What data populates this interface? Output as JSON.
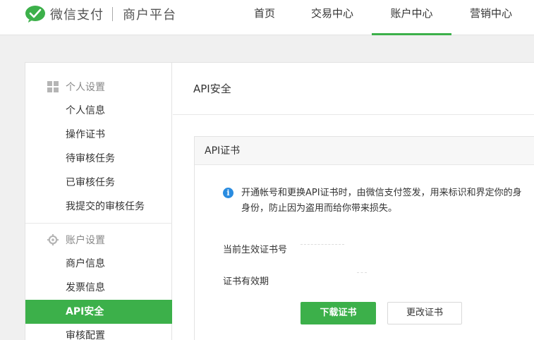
{
  "header": {
    "brand_name": "微信支付",
    "brand_sub": "商户平台",
    "nav": [
      {
        "label": "首页"
      },
      {
        "label": "交易中心"
      },
      {
        "label": "账户中心"
      },
      {
        "label": "营销中心"
      }
    ],
    "active_nav": "账户中心"
  },
  "sidebar": {
    "groups": [
      {
        "title": "个人设置",
        "icon": "grid-icon",
        "items": [
          {
            "label": "个人信息"
          },
          {
            "label": "操作证书"
          },
          {
            "label": "待审核任务"
          },
          {
            "label": "已审核任务"
          },
          {
            "label": "我提交的审核任务"
          }
        ]
      },
      {
        "title": "账户设置",
        "icon": "gear-icon",
        "items": [
          {
            "label": "商户信息"
          },
          {
            "label": "发票信息"
          },
          {
            "label": "API安全"
          },
          {
            "label": "审核配置"
          }
        ]
      }
    ],
    "active_item": "API安全"
  },
  "content": {
    "page_title": "API安全",
    "panel": {
      "title": "API证书",
      "info_line1": "开通帐号和更换API证书时，由微信支付签发，用来标识和界定你的身",
      "info_line2": "身份，防止因为盗用而给你带来损失。",
      "cert_number_label": "当前生效证书号",
      "cert_expiry_label": "证书有效期",
      "download_button": "下载证书",
      "change_button": "更改证书"
    }
  },
  "colors": {
    "accent": "#3cb04a",
    "info": "#2a8ce0"
  }
}
